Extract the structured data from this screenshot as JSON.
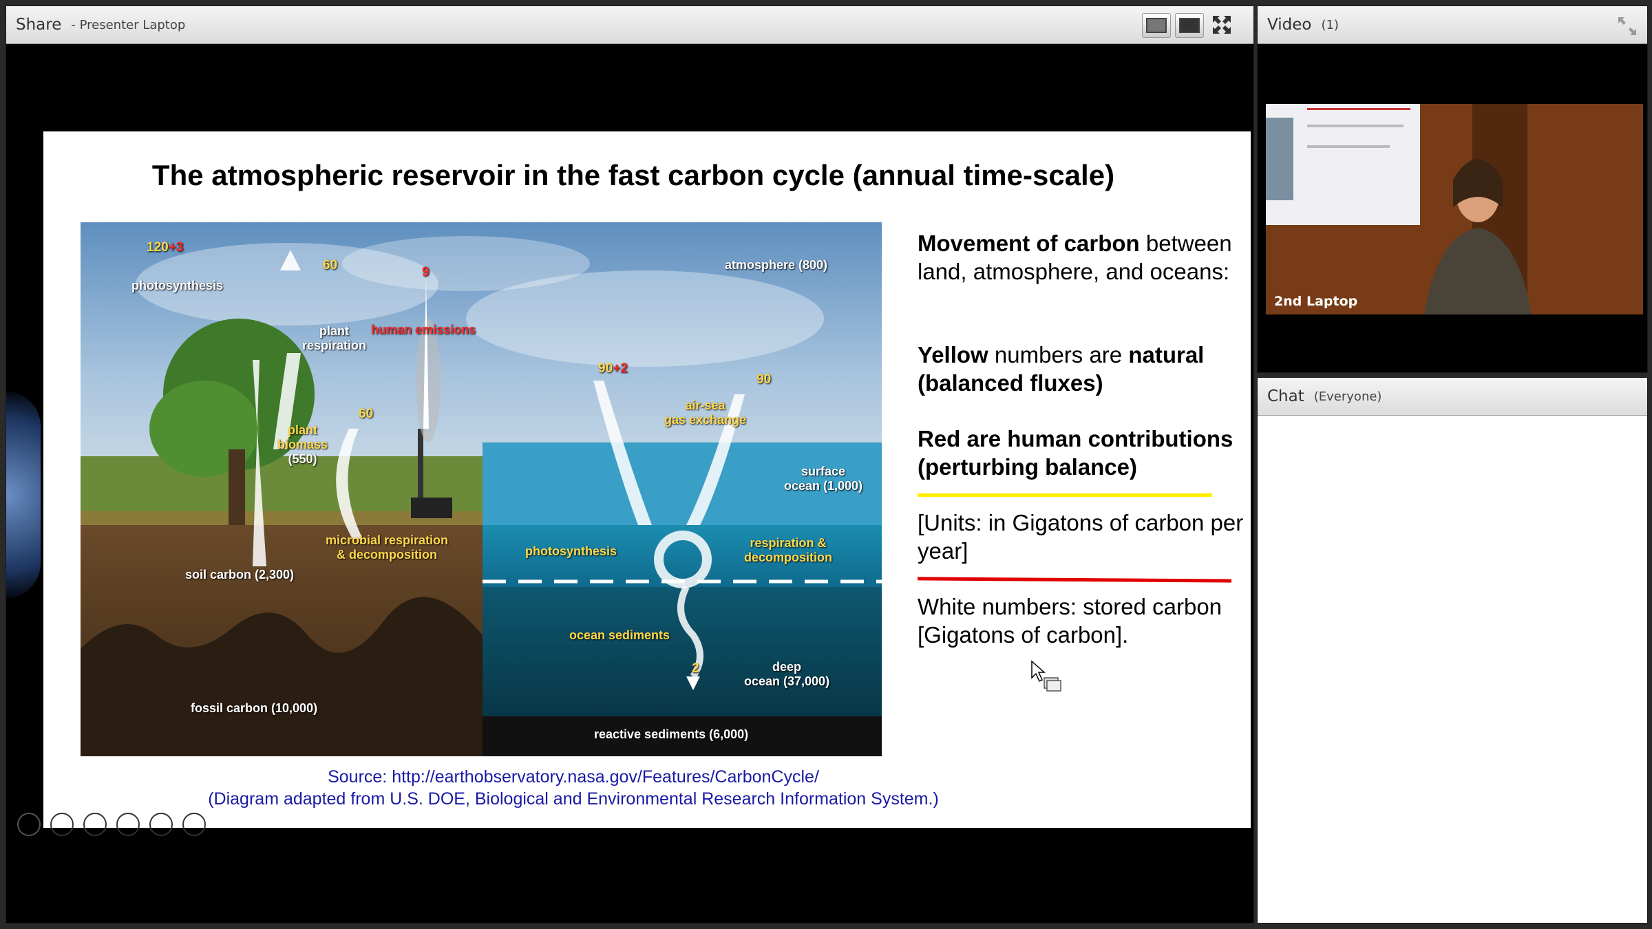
{
  "share_pod": {
    "title": "Share",
    "subtitle": "- Presenter Laptop"
  },
  "slide": {
    "title": "The atmospheric reservoir in the fast carbon cycle (annual time-scale)",
    "intro_bold": "Movement of carbon",
    "intro_rest": "between land, atmosphere, and oceans:",
    "yellow_word": "Yellow",
    "yellow_mid": "numbers are",
    "yellow_bold": "natural",
    "yellow_line2": "(balanced fluxes)",
    "red_line1": "Red are human contributions",
    "red_line2": "(perturbing balance)",
    "units_line1": "[Units: in Gigatons of carbon per",
    "units_line2": "year]",
    "white_line1": "White numbers: stored carbon",
    "white_line2": "[Gigatons of carbon].",
    "source_line1": "Source: http://earthobservatory.nasa.gov/Features/CarbonCycle/",
    "source_line2": "(Diagram adapted from U.S. DOE, Biological and Environmental Research Information System.)"
  },
  "diagram": {
    "labels": {
      "photo_num": "120",
      "photo_plus": "+3",
      "photosynthesis": "photosynthesis",
      "resp_num": "60",
      "plant_respiration_1": "plant",
      "plant_respiration_2": "respiration",
      "human_num": "9",
      "human_emissions": "human emissions",
      "atmosphere": "atmosphere (800)",
      "ocean_in": "90",
      "ocean_in_plus": "+2",
      "ocean_out": "90",
      "airsea_1": "air-sea",
      "airsea_2": "gas exchange",
      "biomass_1": "plant",
      "biomass_2": "biomass",
      "biomass_3": "(550)",
      "micro_num": "60",
      "surface_1": "surface",
      "surface_2": "ocean (1,000)",
      "micro_1": "microbial respiration",
      "micro_2": "& decomposition",
      "soil": "soil carbon (2,300)",
      "ocean_photo": "photosynthesis",
      "ocean_resp_1": "respiration &",
      "ocean_resp_2": "decomposition",
      "sediments": "ocean sediments",
      "sed_num": "2",
      "deep_1": "deep",
      "deep_2": "ocean (37,000)",
      "fossil": "fossil carbon (10,000)",
      "reactive": "reactive sediments (6,000)"
    }
  },
  "video_pod": {
    "title": "Video",
    "count": "(1)",
    "camera_label": "2nd Laptop"
  },
  "chat_pod": {
    "title": "Chat",
    "audience": "(Everyone)"
  },
  "colors": {
    "yellow_underline": "#ffee00",
    "red_underline": "#e00000",
    "source_link": "#1a1aa6"
  }
}
